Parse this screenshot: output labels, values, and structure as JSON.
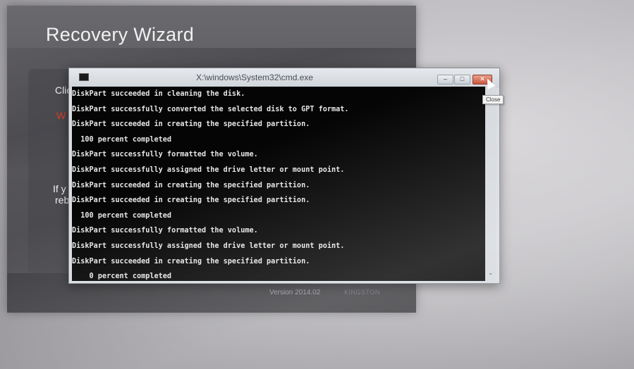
{
  "wizard": {
    "title": "Recovery Wizard",
    "text_clic": "Clic",
    "text_warn": "W",
    "text_ify": "If y",
    "text_reb": "reb",
    "version": "Version 2014.02",
    "brand": "KINGSTON"
  },
  "cmd": {
    "title": "X:\\windows\\System32\\cmd.exe",
    "buttons": {
      "minimize": "–",
      "maximize": "□",
      "close": "✕"
    },
    "tooltip": "Close",
    "lines": [
      "DiskPart succeeded in cleaning the disk.",
      "DiskPart successfully converted the selected disk to GPT format.",
      "DiskPart succeeded in creating the specified partition.",
      "  100 percent completed",
      "DiskPart successfully formatted the volume.",
      "DiskPart successfully assigned the drive letter or mount point.",
      "DiskPart succeeded in creating the specified partition.",
      "DiskPart succeeded in creating the specified partition.",
      "  100 percent completed",
      "DiskPart successfully formatted the volume.",
      "DiskPart successfully assigned the drive letter or mount point.",
      "DiskPart succeeded in creating the specified partition.",
      "    0 percent completed"
    ],
    "scroll_arrow": "⌄"
  },
  "colors": {
    "warn_red": "#e23a2a",
    "console_bg": "#050505",
    "console_text": "#e6e6e6"
  }
}
